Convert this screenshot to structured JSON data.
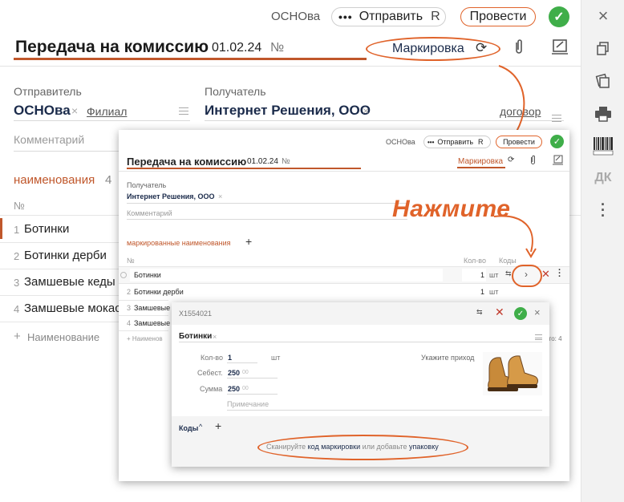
{
  "header": {
    "org_name": "ОСНОва",
    "send_label": "Отправить",
    "send_shortcut": "R",
    "post_label": "Провести",
    "doc_title": "Передача на комиссию",
    "doc_date": "01.02.24",
    "doc_no_label": "№",
    "marking_label": "Маркировка"
  },
  "form": {
    "sender_label": "Отправитель",
    "sender_value": "ОСНОва",
    "branch_link": "Филиал",
    "receiver_label": "Получатель",
    "receiver_value": "Интернет Решения, ООО",
    "contract_link": "договор",
    "comment_placeholder": "Комментарий"
  },
  "items": {
    "title": "наименования",
    "count": "4",
    "no_header": "№",
    "rows": [
      {
        "num": "1",
        "name": "Ботинки"
      },
      {
        "num": "2",
        "name": "Ботинки дерби"
      },
      {
        "num": "3",
        "name": "Замшевые кеды"
      },
      {
        "num": "4",
        "name": "Замшевые мокас"
      }
    ],
    "add_label": "Наименование"
  },
  "overlay": {
    "org_name": "ОСНОва",
    "send_label": "Отправить",
    "send_shortcut": "R",
    "post_label": "Провести",
    "doc_title": "Передача на комиссию",
    "doc_date": "01.02.24",
    "doc_no_label": "№",
    "marking_label": "Маркировка",
    "receiver_label": "Получатель",
    "receiver_value": "Интернет Решения, ООО",
    "comment_placeholder": "Комментарий",
    "marked_items_label": "маркированные наименования",
    "col_no": "№",
    "col_qty": "Кол-во",
    "col_codes": "Коды",
    "rows": [
      {
        "num": "",
        "name": "Ботинки",
        "qty": "1",
        "unit": "шт"
      },
      {
        "num": "2",
        "name": "Ботинки дерби",
        "qty": "1",
        "unit": "шт"
      },
      {
        "num": "3",
        "name": "Замшевые"
      },
      {
        "num": "4",
        "name": "Замшевые"
      }
    ],
    "add_label": "Наименов",
    "total_label": "его: 4"
  },
  "callout": {
    "text": "Нажмите"
  },
  "detail": {
    "code": "X1554021",
    "product_name": "Ботинки",
    "qty_label": "Кол-во",
    "qty_value": "1",
    "qty_unit": "шт",
    "cost_label": "Себест.",
    "cost_value": "250",
    "cost_cents": "00",
    "sum_label": "Сумма",
    "sum_value": "250",
    "sum_cents": "00",
    "note_placeholder": "Примечание",
    "receipt_hint": "Укажите приход",
    "codes_label": "Коды",
    "scan_prefix": "Сканируйте",
    "scan_link1": "код маркировки",
    "scan_middle": "или добавьте",
    "scan_link2": "упаковку"
  },
  "rail": {
    "dk_label": "ДК"
  },
  "colors": {
    "accent": "#e0632a",
    "brand_orange": "#c0572b",
    "navy": "#1b2b4b",
    "success": "#3fae49"
  }
}
